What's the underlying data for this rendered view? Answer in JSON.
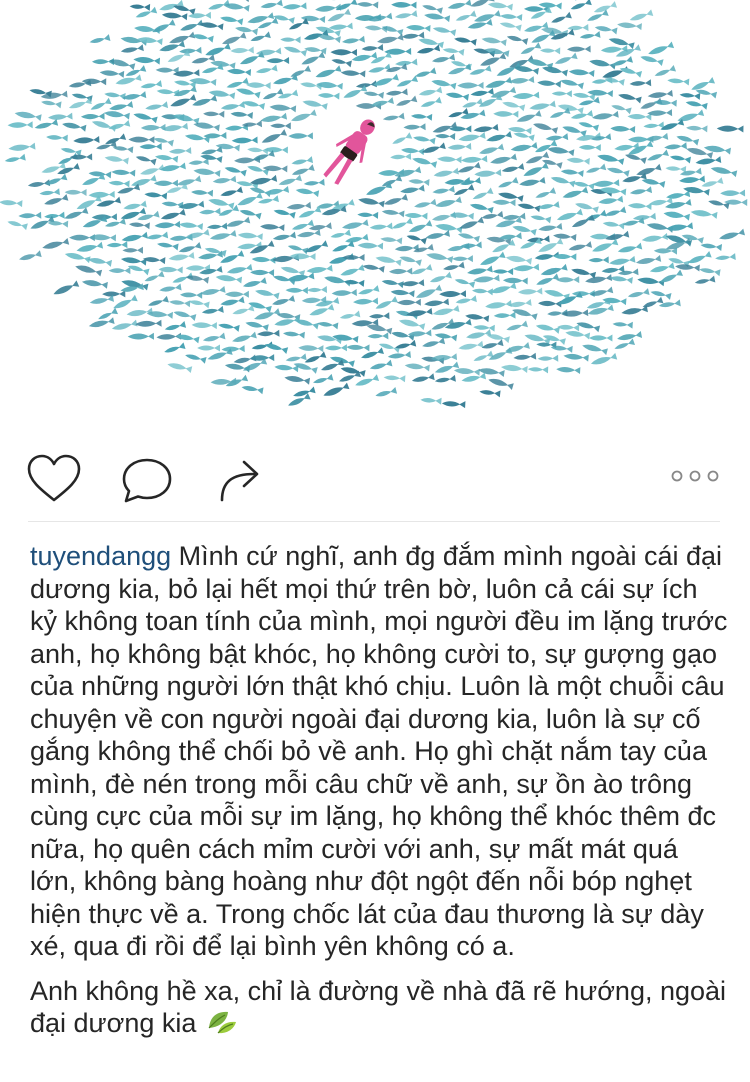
{
  "post": {
    "image": {
      "icon": "fish-school-illustration"
    },
    "actions": {
      "like_icon": "heart-icon",
      "comment_icon": "comment-bubble-icon",
      "share_icon": "share-arrow-icon",
      "more_icon": "more-options-icon"
    },
    "caption": {
      "username": "tuyendangg",
      "paragraph1": "Mình cứ nghĩ, anh đg đắm mình ngoài cái đại dương kia, bỏ lại hết mọi thứ trên bờ, luôn cả cái sự ích kỷ không toan tính của mình, mọi người đều im lặng trước anh, họ không bật khóc, họ không cười to, sự gượng gạo của những người lớn thật khó chịu. Luôn là một chuỗi câu chuyện về con người ngoài đại dương kia, luôn là sự cố gắng không thể chối bỏ về anh. Họ ghì chặt nắm tay của mình, đè nén trong mỗi câu chữ về anh, sự ồn ào trông cùng cực của mỗi sự im lặng, họ không thể khóc thêm đc nữa, họ quên cách mỉm cười với anh, sự mất mát quá lớn, không bàng hoàng như đột ngột đến nỗi bóp nghẹt hiện thực về a. Trong chốc lát của đau thương là sự dày xé, qua đi rồi để lại bình yên không có a.",
      "paragraph2": "Anh không hề xa, chỉ là đường về nhà đã rẽ hướng, ngoài đại dương kia",
      "emoji": "leaves-icon"
    }
  },
  "colors": {
    "fish": "#4aa3b4",
    "swimmer": "#e2559b",
    "username": "#1f4f7a",
    "text": "#262626"
  }
}
